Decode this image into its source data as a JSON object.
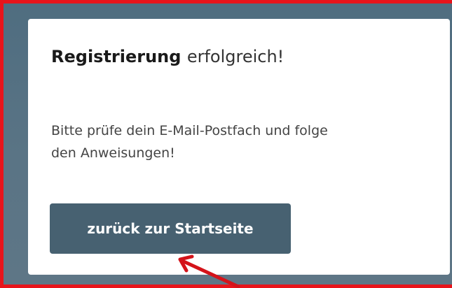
{
  "dialog": {
    "title_strong": "Registrierung",
    "title_rest": "erfolgreich!",
    "message_line1": "Bitte prüfe dein E-Mail-Postfach und folge",
    "message_line2": "den Anweisungen!",
    "back_button_label": "zurück zur Startseite"
  },
  "colors": {
    "frame_border": "#e8141b",
    "background": "#56707f",
    "card": "#ffffff",
    "button": "#476171",
    "annotation_arrow": "#d4131a"
  },
  "icons": [
    "annotation-arrow-icon"
  ]
}
